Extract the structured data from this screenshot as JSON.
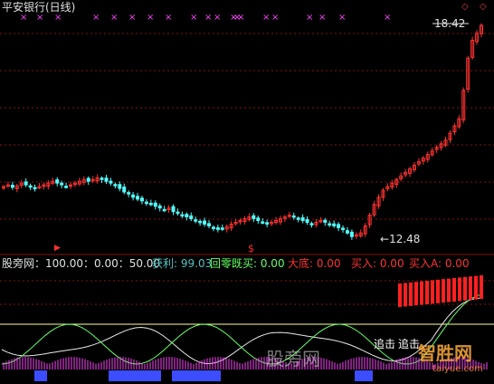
{
  "title": "平安银行(日线)",
  "price_panel": {
    "high_label": "18.42",
    "low_label": "12.48",
    "arrow_left": "←",
    "top_diamond": "◇"
  },
  "indicator_bar": {
    "name": "股旁网：100.00：0.00：50.00",
    "profit": "获利: 99.03",
    "buy_back": "回零既买: 0.00",
    "big_bottom": "大底: 0.00",
    "buy": "买入: 0.00",
    "buy_a": "买入A: 0.00"
  },
  "annotations": [
    "追击",
    "追击"
  ],
  "watermarks": {
    "site_cn": "股旁网",
    "site_logo": "智胜网",
    "site_url": "taiyue.com"
  },
  "colors": {
    "up": "#ff3232",
    "down": "#54fcfc",
    "grid": "#8a1010",
    "white_line": "#e8e8e8",
    "green_line": "#66ff66",
    "yellow_line": "#ffff99",
    "blue_bar": "#3c4cff",
    "magenta": "#ff44ff",
    "red_bar": "#ff2020"
  },
  "chart_data": {
    "type": "candlestick",
    "title": "平安银行(日线)",
    "y_labels": [
      "18.42",
      "12.48"
    ],
    "close_series": [
      13.9,
      13.95,
      13.88,
      13.92,
      14.0,
      13.95,
      13.9,
      13.85,
      13.9,
      13.95,
      14.0,
      14.05,
      14.0,
      13.95,
      13.9,
      13.95,
      14.0,
      14.05,
      14.1,
      14.05,
      14.1,
      14.15,
      14.1,
      14.05,
      14.0,
      13.95,
      13.85,
      13.75,
      13.7,
      13.6,
      13.55,
      13.5,
      13.45,
      13.4,
      13.35,
      13.3,
      13.25,
      13.3,
      13.2,
      13.15,
      13.1,
      13.05,
      13.0,
      12.95,
      12.9,
      12.85,
      12.8,
      12.75,
      12.7,
      12.72,
      12.78,
      12.85,
      12.9,
      12.95,
      13.0,
      13.05,
      13.0,
      12.95,
      12.9,
      12.85,
      12.9,
      12.95,
      13.0,
      13.05,
      13.1,
      13.05,
      13.0,
      12.95,
      12.9,
      12.85,
      12.9,
      12.95,
      12.9,
      12.85,
      12.8,
      12.75,
      12.7,
      12.6,
      12.5,
      12.55,
      12.6,
      12.8,
      13.1,
      13.4,
      13.6,
      13.8,
      13.9,
      14.0,
      14.1,
      14.2,
      14.3,
      14.4,
      14.5,
      14.6,
      14.7,
      14.8,
      14.9,
      15.0,
      15.1,
      15.2,
      15.4,
      15.6,
      15.8,
      16.6,
      17.5,
      18.0,
      18.2,
      18.42
    ]
  }
}
